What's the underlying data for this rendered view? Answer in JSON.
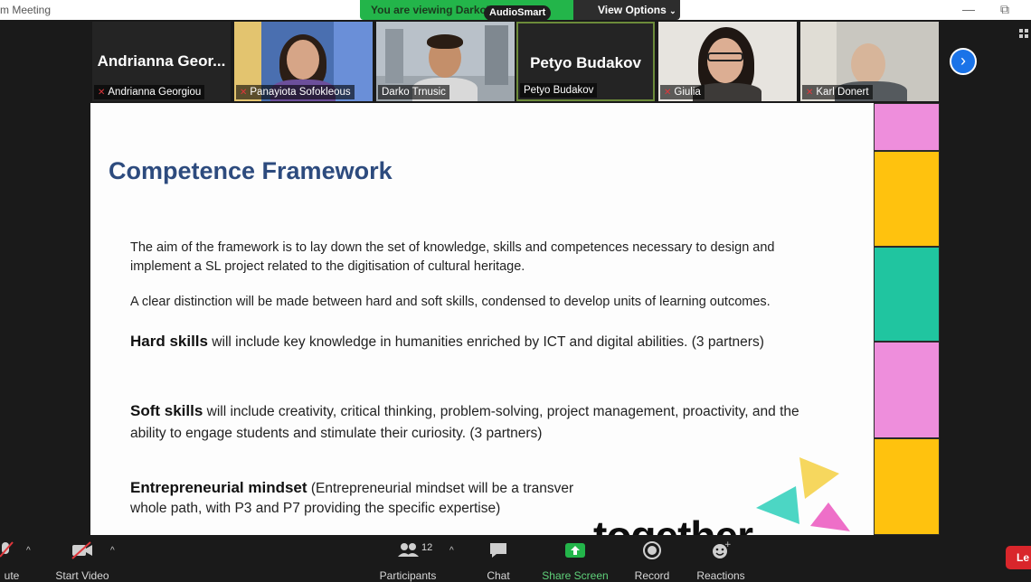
{
  "window": {
    "title": "m Meeting",
    "minimize": "—",
    "restore": "⧉"
  },
  "banner": {
    "viewing_text": "You are viewing Darko's screen",
    "view_options": "View Options",
    "audiosmart": "AudioSmart"
  },
  "gallery": {
    "tiles": [
      {
        "big_name": "Andrianna Geor...",
        "nameplate": "Andrianna Georgiou",
        "muted": true
      },
      {
        "nameplate": "Panayiota Sofokleous",
        "muted": true
      },
      {
        "nameplate": "Darko Trnusic",
        "muted": false
      },
      {
        "big_name": "Petyo Budakov",
        "nameplate": "Petyo Budakov",
        "muted": false,
        "active": true
      },
      {
        "nameplate": "Giulia",
        "muted": true
      },
      {
        "nameplate": "Karl Donert",
        "muted": true
      }
    ],
    "next_icon": "›"
  },
  "slide": {
    "title": "Competence Framework",
    "para1": "The aim of the framework is to lay down the set of knowledge, skills and competences necessary to design and implement a SL project related to the digitisation of cultural heritage.",
    "para2": "A clear distinction will be made between hard and soft skills, condensed to develop units of learning outcomes.",
    "hard_lead": "Hard skills",
    "hard_text": " will include key knowledge in humanities enriched by ICT and digital abilities. (3 partners)",
    "soft_lead": "Soft skills",
    "soft_text": " will include creativity, critical thinking, problem-solving, project management, proactivity, and the ability to engage students and stimulate their curiosity. (3 partners)",
    "entre_lead": "Entrepreneurial mindset",
    "entre_text": " (Entrepreneurial mindset will be a transver",
    "entre_text2": "whole path, with P3 and P7 providing the specific expertise)",
    "logo_word": "together"
  },
  "side_blocks": {
    "colors": [
      "#ee8edc",
      "#ffc20e",
      "#20c5a0",
      "#ee8edc",
      "#ffc20e"
    ]
  },
  "toolbar": {
    "mute": "ute",
    "start_video": "Start Video",
    "participants": "Participants",
    "participants_count": "12",
    "chat": "Chat",
    "share_screen": "Share Screen",
    "record": "Record",
    "reactions": "Reactions",
    "leave": "Le"
  },
  "colors": {
    "share_green": "#23b54a",
    "accent_blue": "#1a73e8",
    "slide_title": "#2d4b7e",
    "leave_red": "#d9262b"
  }
}
